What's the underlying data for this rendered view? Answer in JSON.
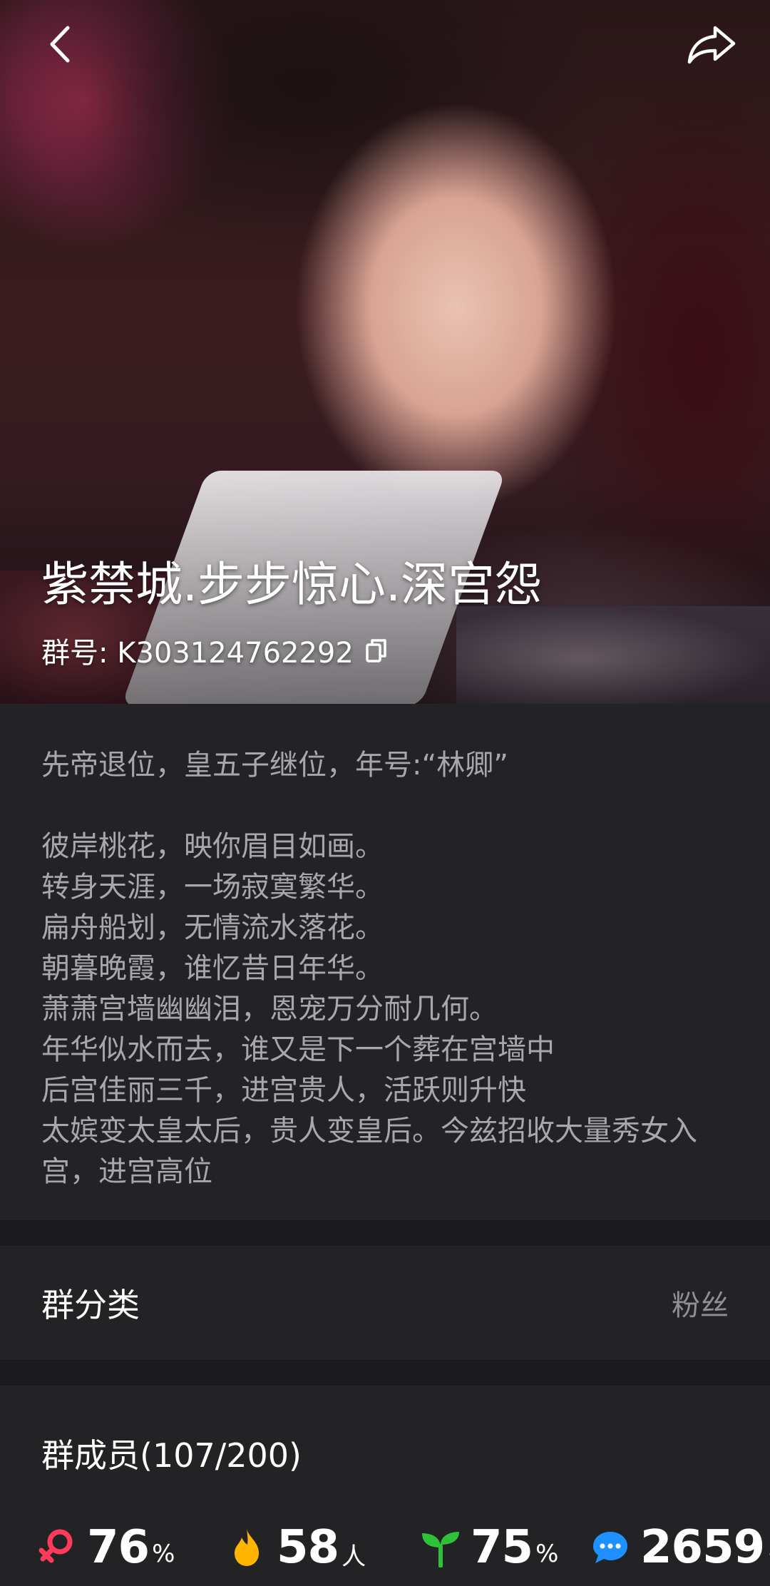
{
  "header": {
    "back_icon": "chevron-left-icon",
    "share_icon": "share-arrow-icon"
  },
  "hero": {
    "title": "紫禁城.步步惊心.深宫怨",
    "group_id_label": "群号: K303124762292",
    "copy_icon": "copy-icon"
  },
  "description": {
    "first_line": "先帝退位，皇五子继位，年号:“林卿”",
    "lines": [
      "彼岸桃花，映你眉目如画。",
      "转身天涯，一场寂寞繁华。",
      "扁舟船划，无情流水落花。",
      "朝暮晚霞，谁忆昔日年华。",
      "萧萧宫墙幽幽泪，恩宠万分耐几何。",
      "年华似水而去，谁又是下一个葬在宫墙中",
      "后宫佳丽三千，进宫贵人，活跃则升快",
      "太嫔变太皇太后，贵人变皇后。今兹招收大量秀女入",
      "宫，进宫高位"
    ]
  },
  "category": {
    "label": "群分类",
    "value": "粉丝"
  },
  "members": {
    "title": "群成员(107/200)",
    "stats": [
      {
        "icon": "female-icon",
        "value": "76",
        "unit": "%",
        "color": "#ff3b5c"
      },
      {
        "icon": "flame-icon",
        "value": "58",
        "unit": "人",
        "color": "#ffb400"
      },
      {
        "icon": "sprout-icon",
        "value": "75",
        "unit": "%",
        "color": "#2fc13a"
      },
      {
        "icon": "chat-bubble-icon",
        "value": "2659",
        "unit": "+",
        "color": "#1e90ff"
      }
    ]
  }
}
